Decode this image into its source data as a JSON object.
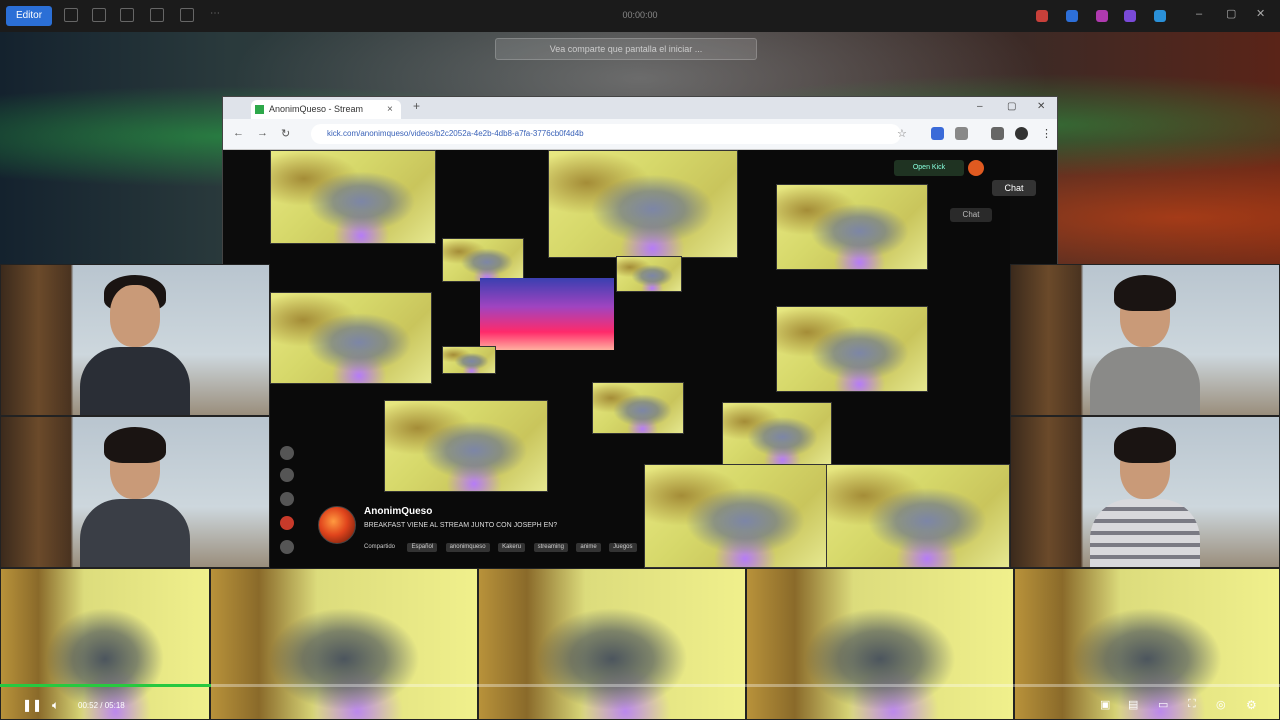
{
  "os_bar": {
    "app_button": "Editor",
    "title": "00:00:00"
  },
  "notification": "Vea comparte que pantalla el iniciar ...",
  "browser": {
    "tab_title": "AnonimQueso - Stream",
    "url": "kick.com/anonimqueso/videos/b2c2052a-4e2b-4db8-a7fa-3776cb0f4d4b",
    "chat_label": "Chat",
    "chat_label_secondary": "Chat",
    "live_label": "Open Kick"
  },
  "stream": {
    "channel_name": "AnonimQueso",
    "title": "BREAKFAST VIENE AL STREAM JUNTO CON JOSEPH EN?",
    "category_label": "Compartido",
    "tags": [
      "Español",
      "anonimqueso",
      "Kakeru",
      "streaming",
      "anime",
      "Juegos"
    ]
  },
  "player": {
    "current_time": "00:52",
    "duration": "05:18",
    "time_separator": " / ",
    "progress": 0.165
  },
  "icons": [
    "pause-icon",
    "volume-icon",
    "settings-icon",
    "fullscreen-icon",
    "pip-icon",
    "theater-icon",
    "subtitles-icon",
    "clip-icon"
  ]
}
